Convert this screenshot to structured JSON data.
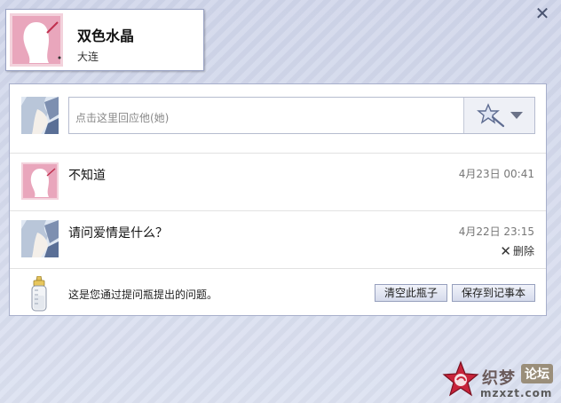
{
  "header": {
    "name": "双色水晶",
    "city": "大连",
    "close_icon": "close-icon"
  },
  "reply": {
    "placeholder": "点击这里回应他(她)",
    "emote_icon": "magic-wand-star-icon"
  },
  "messages": [
    {
      "text": "不知道",
      "time": "4月23日 00:41"
    },
    {
      "text": "请问爱情是什么？",
      "time": "4月22日 23:15",
      "delete_label": "删除"
    }
  ],
  "bottle": {
    "note": "这是您通过提问瓶提出的问题。",
    "clear_label": "清空此瓶子",
    "save_label": "保存到记事本"
  },
  "watermark": {
    "text1": "织梦",
    "text2": "论坛",
    "text3": "mzxzt.com"
  },
  "colors": {
    "panel_border": "#a7afcb",
    "button_border": "#97a0bd",
    "background": "#d7ddee"
  }
}
